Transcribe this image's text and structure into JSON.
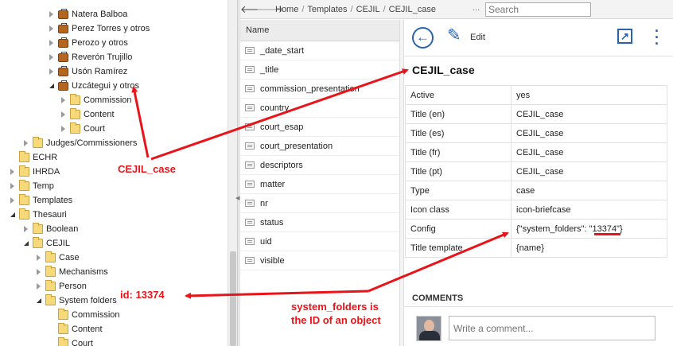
{
  "tree": {
    "items": [
      {
        "label": "Natera Balboa",
        "icon": "briefcase-icon",
        "expander": "collapsed"
      },
      {
        "label": "Perez Torres y otros",
        "icon": "briefcase-icon",
        "expander": "collapsed"
      },
      {
        "label": "Perozo y otros",
        "icon": "briefcase-icon",
        "expander": "collapsed"
      },
      {
        "label": "Reverón Trujillo",
        "icon": "briefcase-icon",
        "expander": "collapsed"
      },
      {
        "label": "Usón Ramírez",
        "icon": "briefcase-icon",
        "expander": "collapsed"
      },
      {
        "label": "Uzcátegui y otros",
        "icon": "briefcase-icon",
        "expander": "expanded"
      },
      {
        "label": "Commission",
        "icon": "folder-icon",
        "expander": "collapsed"
      },
      {
        "label": "Content",
        "icon": "folder-icon",
        "expander": "collapsed"
      },
      {
        "label": "Court",
        "icon": "folder-icon",
        "expander": "collapsed"
      },
      {
        "label": "Judges/Commissioners",
        "icon": "folder-icon",
        "expander": "collapsed"
      },
      {
        "label": "ECHR",
        "icon": "folder-icon",
        "expander": "none"
      },
      {
        "label": "IHRDA",
        "icon": "folder-icon",
        "expander": "collapsed"
      },
      {
        "label": "Temp",
        "icon": "folder-icon",
        "expander": "collapsed"
      },
      {
        "label": "Templates",
        "icon": "folder-icon",
        "expander": "collapsed"
      },
      {
        "label": "Thesauri",
        "icon": "folder-icon",
        "expander": "expanded"
      },
      {
        "label": "Boolean",
        "icon": "folder-icon",
        "expander": "collapsed"
      },
      {
        "label": "CEJIL",
        "icon": "folder-icon",
        "expander": "expanded"
      },
      {
        "label": "Case",
        "icon": "folder-icon",
        "expander": "collapsed"
      },
      {
        "label": "Mechanisms",
        "icon": "folder-icon",
        "expander": "collapsed"
      },
      {
        "label": "Person",
        "icon": "folder-icon",
        "expander": "collapsed"
      },
      {
        "label": "System folders",
        "icon": "folder-icon",
        "expander": "expanded"
      },
      {
        "label": "Commission",
        "icon": "folder-icon",
        "expander": "none"
      },
      {
        "label": "Content",
        "icon": "folder-icon",
        "expander": "none"
      },
      {
        "label": "Court",
        "icon": "folder-icon",
        "expander": "none"
      }
    ]
  },
  "topbar": {
    "back_icon": "arrow-left-icon",
    "forward_icon": "arrow-right-icon",
    "breadcrumbs": [
      "Home",
      "Templates",
      "CEJIL",
      "CEJIL_case"
    ],
    "separator": "/",
    "more": "...",
    "search_placeholder": "Search"
  },
  "list": {
    "header": "Name",
    "items": [
      "_date_start",
      "_title",
      "commission_presentation",
      "country",
      "court_esap",
      "court_presentation",
      "descriptors",
      "matter",
      "nr",
      "status",
      "uid",
      "visible"
    ]
  },
  "panel": {
    "edit_label": "Edit",
    "title": "CEJIL_case",
    "properties": [
      {
        "key": "Active",
        "value": "yes"
      },
      {
        "key": "Title (en)",
        "value": "CEJIL_case"
      },
      {
        "key": "Title (es)",
        "value": "CEJIL_case"
      },
      {
        "key": "Title (fr)",
        "value": "CEJIL_case"
      },
      {
        "key": "Title (pt)",
        "value": "CEJIL_case"
      },
      {
        "key": "Type",
        "value": "case"
      },
      {
        "key": "Icon class",
        "value": "icon-briefcase"
      },
      {
        "key": "Config",
        "value": "{\"system_folders\": \"13374\"}"
      },
      {
        "key": "Title template",
        "value": "{name}"
      }
    ],
    "comments_title": "COMMENTS",
    "comment_placeholder": "Write a comment..."
  },
  "annotations": {
    "cejil_case": "CEJIL_case",
    "id_label": "id: 13374",
    "note_line1": "system_folders is",
    "note_line2": "the ID of an object",
    "color": "#e8141a"
  }
}
